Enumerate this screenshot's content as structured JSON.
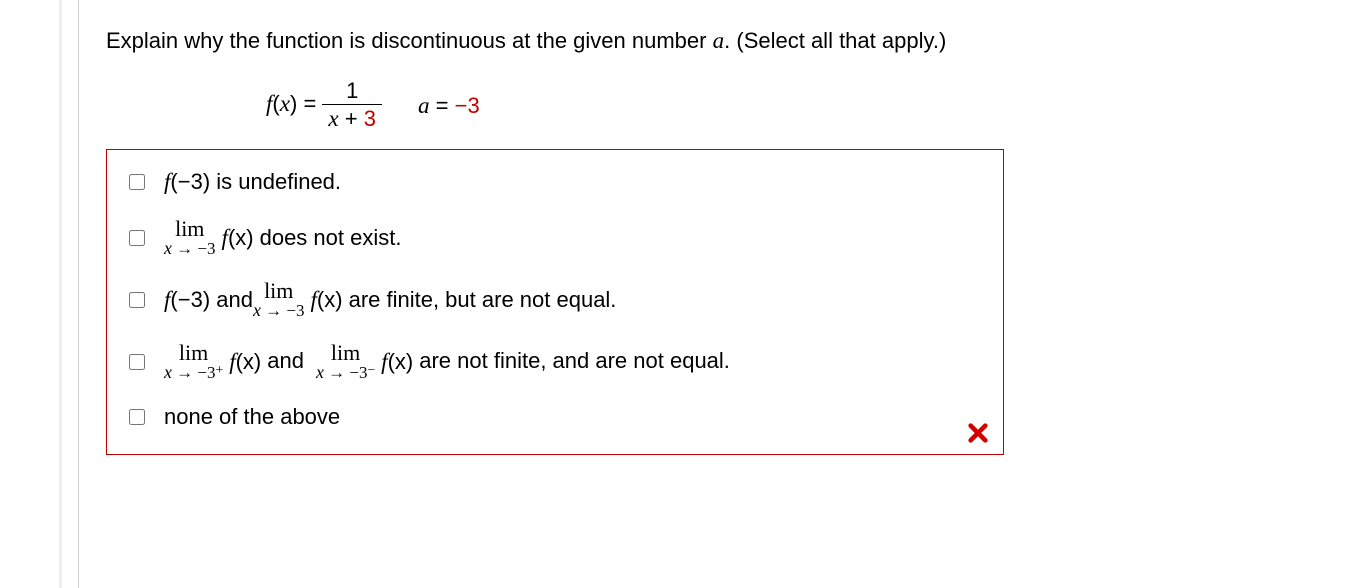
{
  "prompt": {
    "text_before": "Explain why the function is discontinuous at the given number ",
    "var": "a",
    "text_after": ". (Select all that apply.)"
  },
  "equation": {
    "lhs_var": "f",
    "lhs_arg": "x",
    "eq": " = ",
    "frac_num": "1",
    "frac_den_var": "x",
    "frac_den_rest": " + ",
    "frac_den_const": "3",
    "rhs_var": "a",
    "rhs_eq": " = ",
    "rhs_val": "−3"
  },
  "options": [
    {
      "id": "opt1",
      "parts": {
        "p1": "f",
        "p2": "(−3) is undefined."
      }
    },
    {
      "id": "opt2",
      "parts": {
        "lim_top": "lim",
        "lim_bot_var": "x",
        "lim_bot_rest": " → −3",
        "fx_f": "f",
        "fx_rest": "(x)",
        "tail": " does not exist."
      }
    },
    {
      "id": "opt3",
      "parts": {
        "f": "f",
        "f_arg": "(−3) and ",
        "lim_top": "lim",
        "lim_bot_var": "x",
        "lim_bot_rest": " → −3",
        "fx_f": "f",
        "fx_rest": "(x)",
        "tail": " are finite, but are not equal."
      }
    },
    {
      "id": "opt4",
      "parts": {
        "lim1_top": "lim",
        "lim1_bot_var": "x",
        "lim1_bot_rest": " → −3",
        "lim1_sup": "+",
        "fx1_f": "f",
        "fx1_rest": "(x)",
        "mid": " and ",
        "lim2_top": "lim",
        "lim2_bot_var": "x",
        "lim2_bot_rest": " → −3",
        "lim2_sup": "−",
        "fx2_f": "f",
        "fx2_rest": "(x)",
        "tail": " are not finite, and are not equal."
      }
    },
    {
      "id": "opt5",
      "parts": {
        "text": "none of the above"
      }
    }
  ]
}
